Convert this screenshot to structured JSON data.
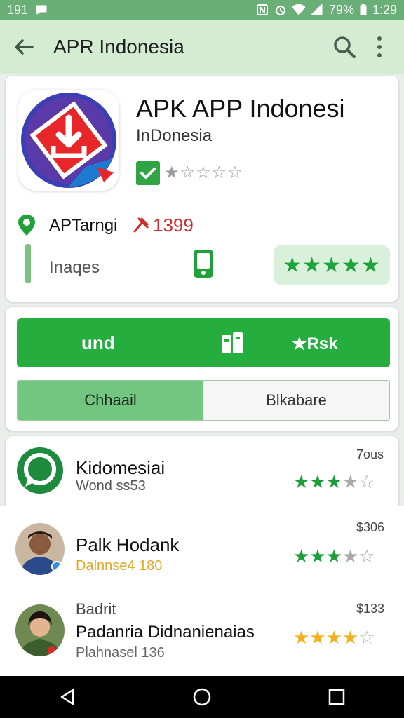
{
  "status_bar": {
    "left_text": "191",
    "battery": "79%",
    "time": "1:29"
  },
  "app_bar": {
    "title": "APR Indonesia"
  },
  "app": {
    "name": "APK APP Indonesi",
    "developer": "InDonesia",
    "rating_stars_empty": "★☆☆☆☆",
    "location_label": "APTarngi",
    "count_value": "1399",
    "images_label": "Inaqes",
    "rating_pill_stars": "★★★★★",
    "colors": {
      "accent_green": "#25ad3e",
      "count_red": "#d12b2b",
      "icon_blue": "#3a3fb5"
    }
  },
  "actions": {
    "primary_left_label": "und",
    "primary_right_label": "★Rsk",
    "tabs": [
      {
        "label": "Chhaail",
        "active": true
      },
      {
        "label": "Blkabare",
        "active": false
      }
    ]
  },
  "reviews": [
    {
      "title": "Kidomesiai",
      "subtitle": "Wond ss53",
      "subtitle_color": "#555555",
      "time": "7ous",
      "stars_full": "★★★",
      "stars_rest": "★☆",
      "star_color": "#1e9e3a"
    },
    {
      "title": "Palk Hodank",
      "subtitle": "Dalnnse4 180",
      "subtitle_color": "#e0a82a",
      "time": "$306",
      "stars_full": "★★★",
      "stars_rest": "★☆",
      "star_color": "#1e9e3a"
    },
    {
      "label": "Badrit",
      "title": "Padanria Didnanienaias",
      "subtitle": "Plahnasel 136",
      "subtitle_color": "#666666",
      "time": "$133",
      "stars_full": "★★★★",
      "stars_rest": "☆",
      "star_color": "#f2b01e"
    }
  ]
}
